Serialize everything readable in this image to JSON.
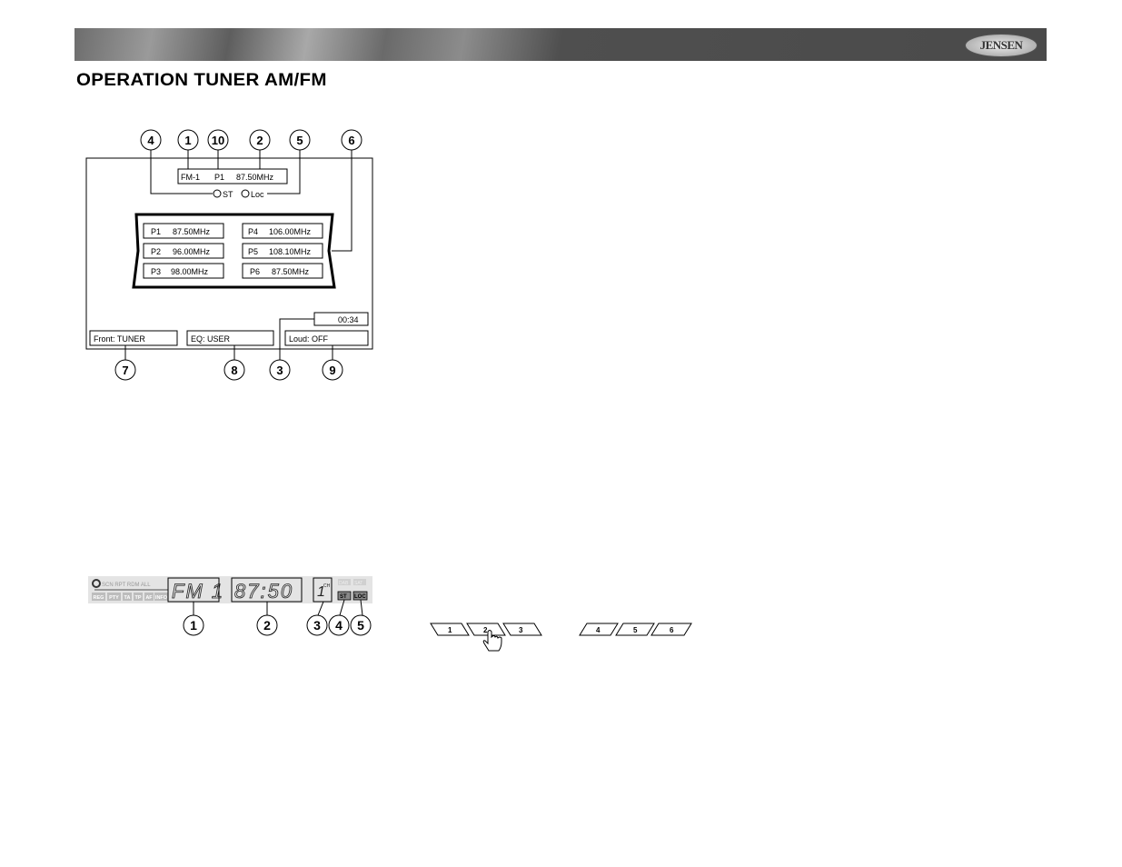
{
  "header": {
    "logo": "JENSEN",
    "title": "OPERATION TUNER AM/FM"
  },
  "screen_diagram": {
    "band": "FM-1",
    "preset": "P1",
    "frequency": "87.50MHz",
    "st_label": "ST",
    "loc_label": "Loc",
    "presets": [
      {
        "label": "P1",
        "freq": "87.50MHz"
      },
      {
        "label": "P2",
        "freq": "96.00MHz"
      },
      {
        "label": "P3",
        "freq": "98.00MHz"
      },
      {
        "label": "P4",
        "freq": "106.00MHz"
      },
      {
        "label": "P5",
        "freq": "108.10MHz"
      },
      {
        "label": "P6",
        "freq": "87.50MHz"
      }
    ],
    "clock": "00:34",
    "front": "Front: TUNER",
    "eq": "EQ: USER",
    "loud": "Loud: OFF",
    "callouts_top": [
      "4",
      "1",
      "10",
      "2",
      "5",
      "6"
    ],
    "callouts_bottom": [
      "7",
      "8",
      "3",
      "9"
    ]
  },
  "lcd_diagram": {
    "band": "FM 1",
    "frequency": "87:50",
    "channel": "1",
    "ch_label": "CH",
    "indicators_top": "SCN RPT RDM ALL",
    "indicators_bottom": [
      "REG",
      "PTY",
      "TA",
      "TP",
      "AF",
      "INFO"
    ],
    "dab": "DAB",
    "sat": "SAT",
    "st": "ST",
    "loc": "LOC",
    "callouts": [
      "1",
      "2",
      "3",
      "4",
      "5"
    ]
  },
  "preset_buttons": [
    "1",
    "2",
    "3",
    "4",
    "5",
    "6"
  ]
}
